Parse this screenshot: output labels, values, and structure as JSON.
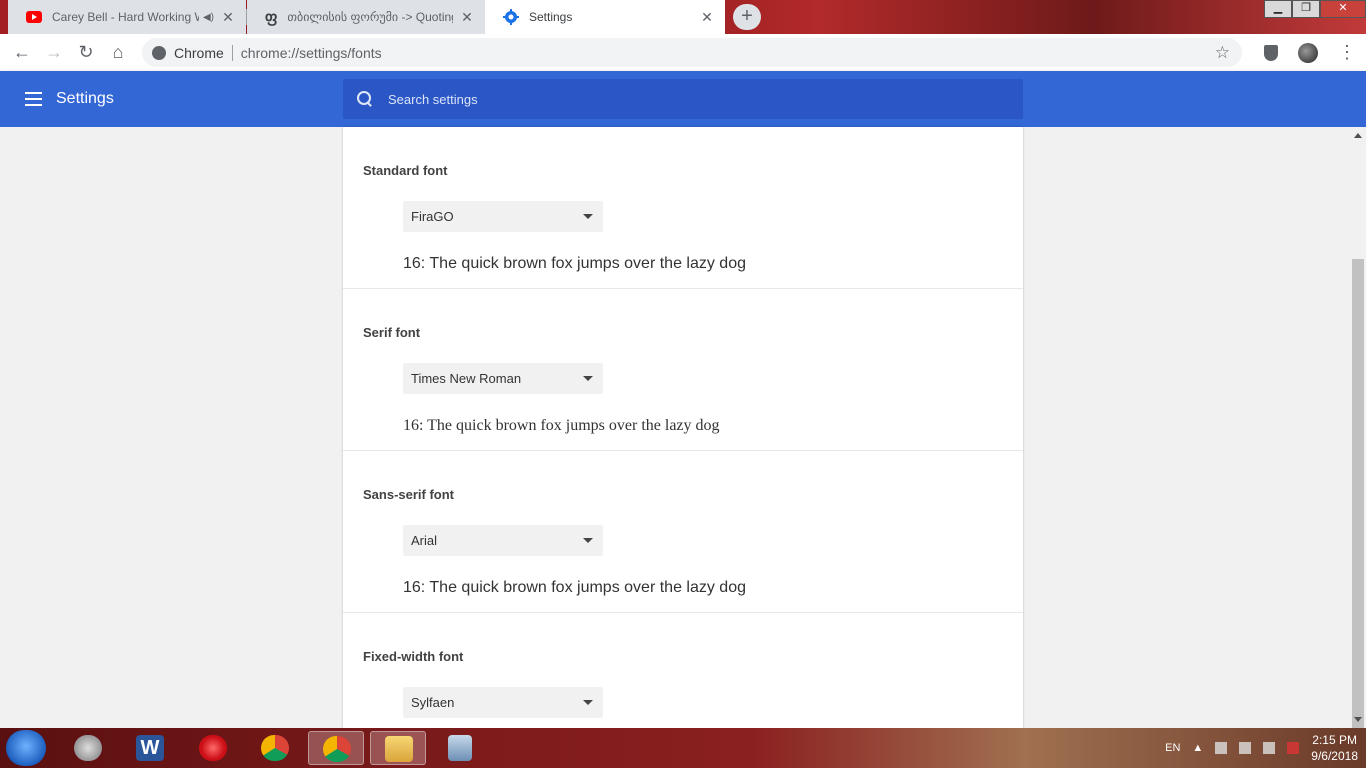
{
  "browser": {
    "tabs": [
      {
        "title": "Carey Bell - Hard Working W",
        "state": "inactive",
        "icon": "youtube-icon",
        "audio": true
      },
      {
        "title": "თბილისის ფორუმი -> Quoting",
        "state": "inactive",
        "icon": "forum-icon"
      },
      {
        "title": "Settings",
        "state": "active",
        "icon": "gear-icon"
      }
    ],
    "new_tab_label": "+",
    "address": {
      "site_label": "Chrome",
      "url": "chrome://settings/fonts"
    }
  },
  "settings": {
    "title": "Settings",
    "search_placeholder": "Search settings"
  },
  "fonts": {
    "sections": [
      {
        "label": "Standard font",
        "selected": "FiraGO",
        "sample": "16: The quick brown fox jumps over the lazy dog"
      },
      {
        "label": "Serif font",
        "selected": "Times New Roman",
        "sample": "16: The quick brown fox jumps over the lazy dog"
      },
      {
        "label": "Sans-serif font",
        "selected": "Arial",
        "sample": "16: The quick brown fox jumps over the lazy dog"
      },
      {
        "label": "Fixed-width font",
        "selected": "Sylfaen"
      }
    ]
  },
  "taskbar": {
    "tray": {
      "language": "EN",
      "time": "2:15 PM",
      "date": "9/6/2018"
    }
  },
  "colors": {
    "settings_header": "#3367d6",
    "search_bg": "#2a56c6",
    "tabstrip_accent": "#a31e22"
  }
}
